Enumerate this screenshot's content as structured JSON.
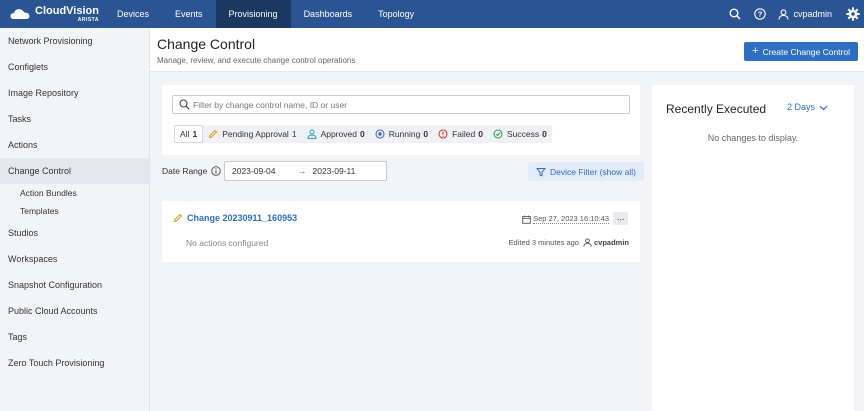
{
  "app": {
    "brand": "CloudVision",
    "brand_sub": "ARISTA"
  },
  "nav": {
    "items": [
      {
        "label": "Devices"
      },
      {
        "label": "Events"
      },
      {
        "label": "Provisioning",
        "active": true
      },
      {
        "label": "Dashboards"
      },
      {
        "label": "Topology"
      }
    ]
  },
  "topright": {
    "icons": [
      "search-icon",
      "help-icon",
      "user-icon",
      "settings-gear-icon"
    ],
    "username": "cvpadmin"
  },
  "sidebar": {
    "items": [
      {
        "label": "Network Provisioning"
      },
      {
        "label": "Configlets"
      },
      {
        "label": "Image Repository"
      },
      {
        "label": "Tasks"
      },
      {
        "label": "Actions"
      },
      {
        "label": "Change Control",
        "active": true
      },
      {
        "label": "Action Bundles",
        "sub": true
      },
      {
        "label": "Templates",
        "sub": true
      },
      {
        "label": "Studios"
      },
      {
        "label": "Workspaces"
      },
      {
        "label": "Snapshot Configuration"
      },
      {
        "label": "Public Cloud Accounts"
      },
      {
        "label": "Tags"
      },
      {
        "label": "Zero Touch Provisioning"
      }
    ]
  },
  "header": {
    "title": "Change Control",
    "subtitle": "Manage, review, and execute change control operations",
    "create_label": "Create Change Control"
  },
  "search": {
    "placeholder": "Filter by change control name, ID or user",
    "value": ""
  },
  "status_filters": {
    "all": {
      "label": "All",
      "count": "1"
    },
    "pending": {
      "label": "Pending Approval",
      "count": "1"
    },
    "approved": {
      "label": "Approved",
      "count": "0"
    },
    "running": {
      "label": "Running",
      "count": "0"
    },
    "failed": {
      "label": "Failed",
      "count": "0"
    },
    "success": {
      "label": "Success",
      "count": "0"
    }
  },
  "date_range": {
    "label": "Date Range",
    "start": "2023-09-04",
    "end": "2023-09-11"
  },
  "device_filter_label": "Device Filter (show all)",
  "change_control": {
    "name": "Change 20230911_160953",
    "date": "Sep 27, 2023 16:10:43",
    "actions_text": "No actions configured",
    "edited": "Edited 3 minutes ago",
    "editor": "cvpadmin"
  },
  "recent": {
    "title": "Recently Executed",
    "range": "2 Days",
    "empty": "No changes to display."
  },
  "colors": {
    "topbar": "#2a5592",
    "topbar_active": "#1a3860",
    "accent": "#2f6fc2",
    "pending": "#e0a020",
    "approved": "#3aa0c8",
    "running": "#4a6fb5",
    "failed": "#d0402f",
    "success": "#3aa54a"
  }
}
